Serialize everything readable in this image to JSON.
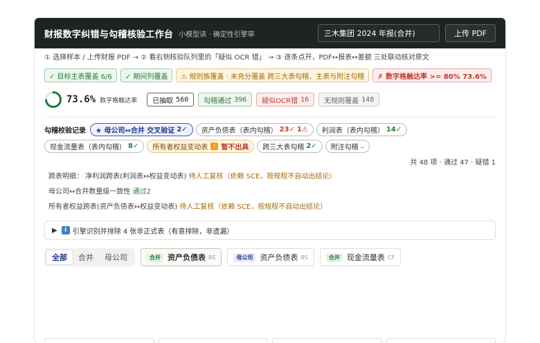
{
  "header": {
    "title": "财报数字纠错与勾稽核验工作台",
    "subtitle": "小模型读 · 确定性引擎审",
    "sample_select": "三木集团 2024 年报(合并)",
    "upload_label": "上传 PDF"
  },
  "steps": "① 选择样本 / 上传财报 PDF  →  ② 看右侧核验队列里的「疑似 OCR 错」  →  ③ 逐条点开，PDF↔报表↔差额 三处联动核对原文",
  "coverage_badges": [
    {
      "label": "✓ 目标主表覆盖 6/6",
      "style": "green"
    },
    {
      "label": "✓ 期间列覆盖",
      "style": "green"
    },
    {
      "label": "⚠ 规则族覆盖 · 未充分覆盖 跨三大表勾稽、主表与附注勾稽",
      "style": "amber"
    },
    {
      "label": "✗ 数字格触达率 >= 80% 73.6%",
      "style": "red"
    }
  ],
  "metrics": {
    "rate": "73.6%",
    "rate_fraction": 0.736,
    "rate_label": "数字格触达率",
    "chips": [
      {
        "label": "已抽取",
        "value": "560",
        "style": "plain"
      },
      {
        "label": "勾稽通过",
        "value": "396",
        "style": "green"
      },
      {
        "label": "疑似OCR错",
        "value": "16",
        "style": "red"
      },
      {
        "label": "无规则覆盖",
        "value": "148",
        "style": "gray"
      }
    ]
  },
  "records": {
    "title": "勾稽校验记录",
    "pills": [
      {
        "label": "★ 母公司↔合并 交叉验证",
        "pass": "2✓",
        "fail": "",
        "style": "active"
      },
      {
        "label": "资产负债表（表内勾稽）",
        "pass": "23✓",
        "fail": "1⚠",
        "style": "normal"
      },
      {
        "label": "利润表（表内勾稽）",
        "pass": "14✓",
        "fail": "",
        "style": "normal"
      },
      {
        "label": "现金流量表（表内勾稽）",
        "pass": "8✓",
        "fail": "",
        "style": "normal"
      },
      {
        "label": "所有者权益变动表",
        "pass": "暂不出具",
        "fail": "",
        "style": "amber"
      },
      {
        "label": "跨三大表勾稽",
        "pass": "2✓",
        "fail": "",
        "style": "normal"
      },
      {
        "label": "附注勾稽 –",
        "pass": "",
        "fail": "",
        "style": "normal"
      }
    ],
    "summary": "共 48 项 · 通过 47 · 疑错 1"
  },
  "detail_lines": {
    "line1_prefix": "跨表明细：  净利润跨表(利润表↔权益变动表)",
    "line1_status": "待人工复核（依赖 SCE，按规程不自动出结论）",
    "line2_prefix": "母公司↔合并数量级一致性",
    "line2_status": "通过2",
    "line3_prefix": "所有者权益跨表(资产负债表↔权益变动表)",
    "line3_status": "待人工复核（依赖 SCE，按规程不自动出结论）"
  },
  "excluded": {
    "arrow": "▶",
    "icon": "i",
    "text": "引擎识别并排除 4 张非正式表（有意排除，非遗漏）"
  },
  "scope_tabs": [
    "全部",
    "合并",
    "母公司"
  ],
  "statement_tabs": [
    {
      "tag": "合并",
      "tag_style": "green",
      "name": "资产负债表",
      "code": "BS",
      "active": true
    },
    {
      "tag": "母公司",
      "tag_style": "blue",
      "name": "资产负债表",
      "code": "BS",
      "active": false
    },
    {
      "tag": "合并",
      "tag_style": "green",
      "name": "现金流量表",
      "code": "CF",
      "active": false
    }
  ]
}
